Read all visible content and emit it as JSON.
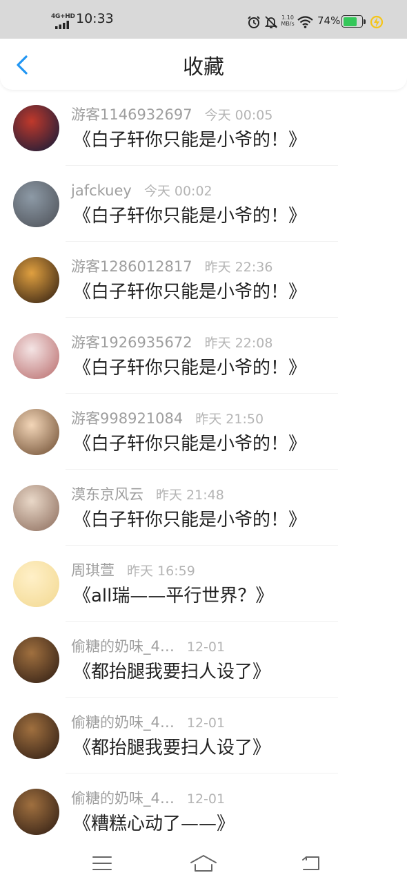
{
  "status_bar": {
    "network": "4G+HD",
    "time": "10:33",
    "speed_value": "1.10",
    "speed_unit": "MB/s",
    "battery_percent": "74%",
    "battery_level": 0.74,
    "icons": [
      "signal-icon",
      "alarm-icon",
      "mute-icon",
      "wifi-icon",
      "battery-icon",
      "charging-icon"
    ]
  },
  "header": {
    "title": "收藏",
    "back_icon": "chevron-left-icon"
  },
  "favorites": [
    {
      "name": "游客1146932697",
      "time": "今天 00:05",
      "title": "《白子轩你只能是小爷的！》",
      "avatar": [
        "#c0392b",
        "#0b1a3a"
      ]
    },
    {
      "name": "jafckuey",
      "time": "今天 00:02",
      "title": "《白子轩你只能是小爷的！》",
      "avatar": [
        "#8d9aa6",
        "#4b4e55"
      ]
    },
    {
      "name": "游客1286012817",
      "time": "昨天 22:36",
      "title": "《白子轩你只能是小爷的！》",
      "avatar": [
        "#e0a040",
        "#2a1a10"
      ]
    },
    {
      "name": "游客1926935672",
      "time": "昨天 22:08",
      "title": "《白子轩你只能是小爷的！》",
      "avatar": [
        "#f4e4e4",
        "#b86a6a"
      ]
    },
    {
      "name": "游客998921084",
      "time": "昨天 21:50",
      "title": "《白子轩你只能是小爷的！》",
      "avatar": [
        "#f3d6b8",
        "#6b4a2f"
      ]
    },
    {
      "name": "漠东京风云",
      "time": "昨天 21:48",
      "title": "《白子轩你只能是小爷的！》",
      "avatar": [
        "#e9d8c8",
        "#8a6a5a"
      ]
    },
    {
      "name": "周琪萱",
      "time": "昨天 16:59",
      "title": "《all瑞——平行世界？》",
      "avatar": [
        "#fff0c8",
        "#f2d890"
      ]
    },
    {
      "name": "偷糖的奶味_4…",
      "time": "12-01",
      "title": "《都抬腿我要扫人设了》",
      "avatar": [
        "#a0703f",
        "#2b1a12"
      ]
    },
    {
      "name": "偷糖的奶味_4…",
      "time": "12-01",
      "title": "《都抬腿我要扫人设了》",
      "avatar": [
        "#a0703f",
        "#2b1a12"
      ]
    },
    {
      "name": "偷糖的奶味_4…",
      "time": "12-01",
      "title": "《糟糕心动了——》",
      "avatar": [
        "#a0703f",
        "#2b1a12"
      ]
    }
  ],
  "nav": {
    "icons": [
      "menu-icon",
      "home-icon",
      "back-icon"
    ]
  },
  "colors": {
    "accent": "#2196f3",
    "name_text": "#9e9e9e",
    "time_text": "#b4b4b4",
    "title_text": "#222222",
    "status_bar_bg": "#d9d9d9",
    "battery_fill": "#34c759",
    "charging": "#f5c518"
  }
}
